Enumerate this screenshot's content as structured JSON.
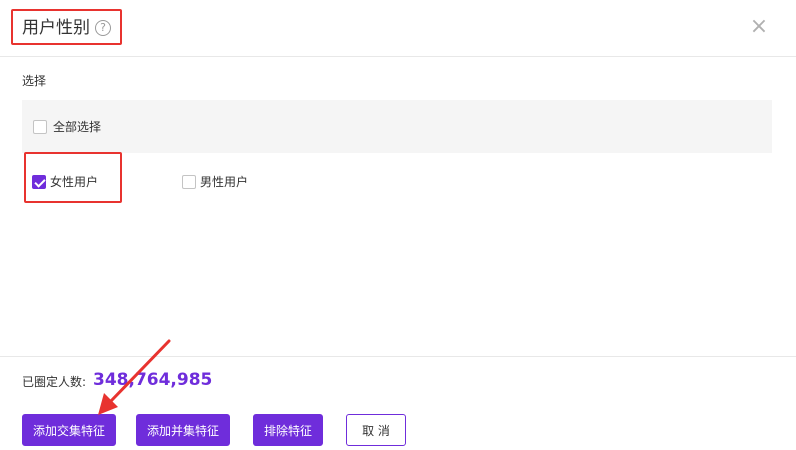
{
  "dialog": {
    "title": "用户性别",
    "help_icon": "?",
    "close_icon": "×"
  },
  "section": {
    "label": "选择",
    "select_all_label": "全部选择",
    "select_all_checked": false
  },
  "options": [
    {
      "label": "女性用户",
      "checked": true
    },
    {
      "label": "男性用户",
      "checked": false
    }
  ],
  "footer": {
    "count_label": "已圈定人数:",
    "count_value": "348,764,985"
  },
  "buttons": {
    "add_intersection": "添加交集特征",
    "add_union": "添加并集特征",
    "exclude": "排除特征",
    "cancel": "取 消"
  },
  "colors": {
    "accent": "#6f2ddb",
    "annotation": "#e8332f"
  }
}
